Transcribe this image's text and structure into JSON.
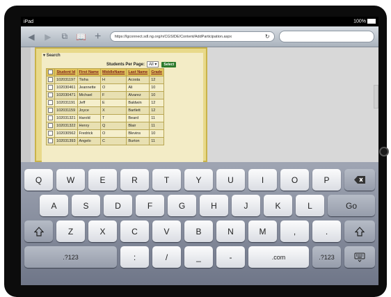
{
  "status": {
    "device": "iPad",
    "battery": "100%"
  },
  "browser": {
    "url": "https://lgconnect.sdl.ng.org/n/CGSIDE/Content/AddParticipation.aspx",
    "reload_icon": "reload-icon"
  },
  "page": {
    "search_label": "Search",
    "per_page_label": "Students Per Page:",
    "per_page_value": "All",
    "select_button": "Select",
    "columns": [
      "Student Id",
      "First Name",
      "MiddleName",
      "Last Name",
      "Grade"
    ],
    "rows": [
      [
        "102031197",
        "Tisha",
        "H",
        "Acosta",
        "12"
      ],
      [
        "102030461",
        "Jeannette",
        "O",
        "Ali",
        "10"
      ],
      [
        "102030471",
        "Michael",
        "F",
        "Alvarez",
        "10"
      ],
      [
        "102031191",
        "Jeff",
        "E",
        "Baldwin",
        "12"
      ],
      [
        "102031159",
        "Joyce",
        "X",
        "Bartlett",
        "12"
      ],
      [
        "102031321",
        "Harold",
        "T",
        "Beard",
        "11"
      ],
      [
        "102031322",
        "Henry",
        "Q",
        "Blair",
        "11"
      ],
      [
        "102030562",
        "Fredrick",
        "O",
        "Blevins",
        "10"
      ],
      [
        "102031393",
        "Angelo",
        "C",
        "Burton",
        "11"
      ]
    ]
  },
  "keyboard": {
    "row1": [
      "Q",
      "W",
      "E",
      "R",
      "T",
      "Y",
      "U",
      "I",
      "O",
      "P"
    ],
    "row2": [
      "A",
      "S",
      "D",
      "F",
      "G",
      "H",
      "J",
      "K",
      "L"
    ],
    "go": "Go",
    "row3": [
      "Z",
      "X",
      "C",
      "V",
      "B",
      "N",
      "M",
      ",",
      "."
    ],
    "num1": ".?123",
    "bottom": [
      ":",
      "/",
      "_",
      "-",
      ".com"
    ],
    "num2": ".?123"
  }
}
